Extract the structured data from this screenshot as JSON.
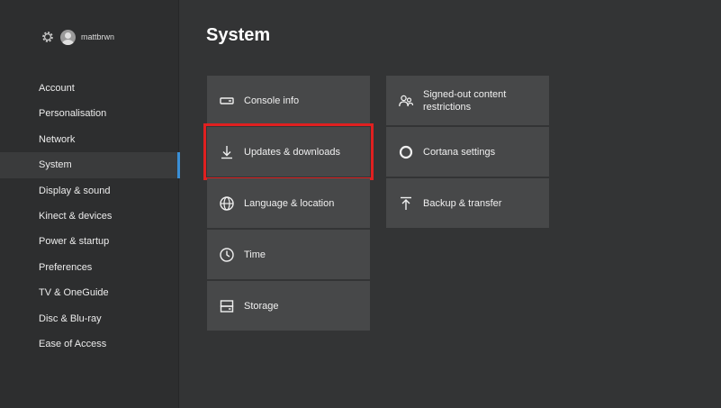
{
  "profile": {
    "username": "mattbrwn",
    "settings_icon": "gear-icon",
    "avatar_icon": "avatar"
  },
  "sidebar": {
    "items": [
      {
        "label": "Account"
      },
      {
        "label": "Personalisation"
      },
      {
        "label": "Network"
      },
      {
        "label": "System",
        "active": true
      },
      {
        "label": "Display & sound"
      },
      {
        "label": "Kinect & devices"
      },
      {
        "label": "Power & startup"
      },
      {
        "label": "Preferences"
      },
      {
        "label": "TV & OneGuide"
      },
      {
        "label": "Disc & Blu-ray"
      },
      {
        "label": "Ease of Access"
      }
    ]
  },
  "main": {
    "title": "System",
    "tiles": [
      {
        "label": "Console info",
        "icon": "console-icon"
      },
      {
        "label": "Updates & downloads",
        "icon": "download-icon",
        "highlighted": true
      },
      {
        "label": "Language & location",
        "icon": "globe-icon"
      },
      {
        "label": "Time",
        "icon": "clock-icon"
      },
      {
        "label": "Storage",
        "icon": "storage-icon"
      },
      {
        "label": "Signed-out content restrictions",
        "icon": "people-icon"
      },
      {
        "label": "Cortana settings",
        "icon": "cortana-circle-icon"
      },
      {
        "label": "Backup & transfer",
        "icon": "upload-icon"
      }
    ]
  },
  "colors": {
    "background": "#333435",
    "sidebar": "#2d2e2f",
    "tile": "#474849",
    "active_indicator": "#3a8fd6",
    "highlight_outline": "#e02020"
  }
}
